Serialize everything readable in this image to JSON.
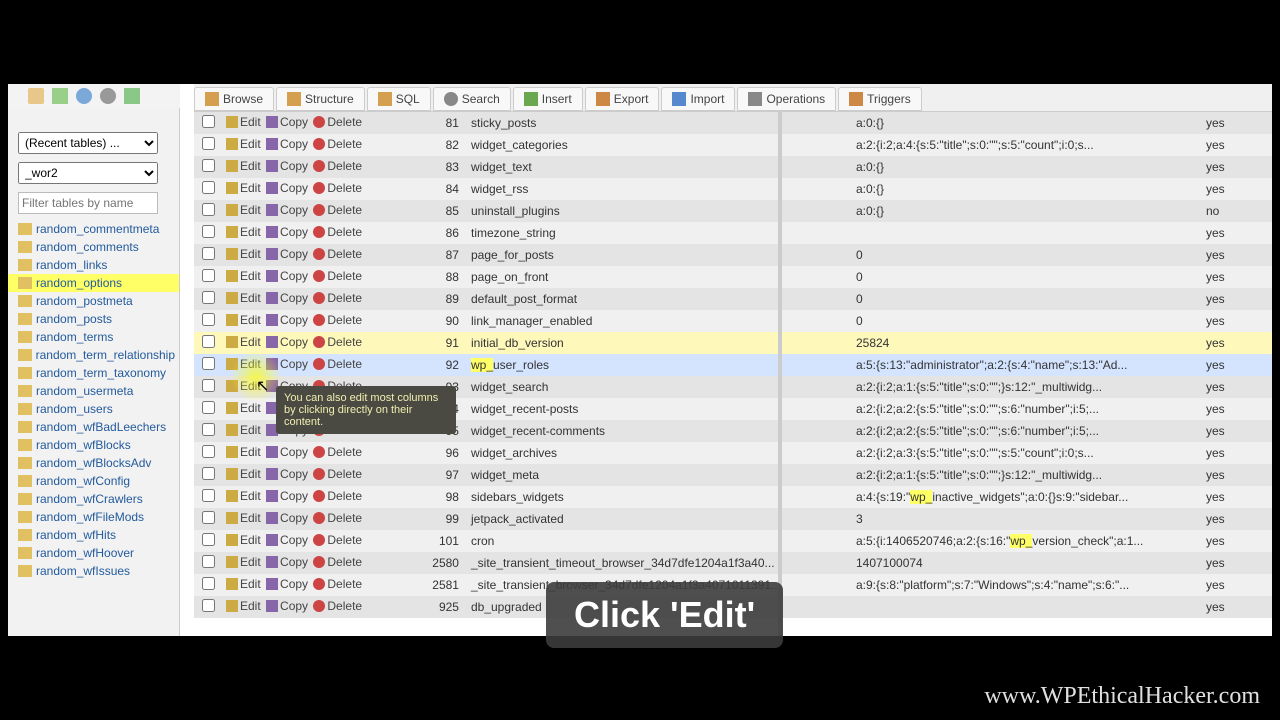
{
  "tabs": [
    {
      "label": "Browse",
      "ico": "browse"
    },
    {
      "label": "Structure",
      "ico": "struct"
    },
    {
      "label": "SQL",
      "ico": "sql"
    },
    {
      "label": "Search",
      "ico": "search"
    },
    {
      "label": "Insert",
      "ico": "insert"
    },
    {
      "label": "Export",
      "ico": "export"
    },
    {
      "label": "Import",
      "ico": "import"
    },
    {
      "label": "Operations",
      "ico": "ops"
    },
    {
      "label": "Triggers",
      "ico": "trig"
    }
  ],
  "sidebar": {
    "recent_label": "(Recent tables) ...",
    "db_label": "_wor2",
    "filter_placeholder": "Filter tables by name",
    "tables": [
      "random_commentmeta",
      "random_comments",
      "random_links",
      "random_options",
      "random_postmeta",
      "random_posts",
      "random_terms",
      "random_term_relationship",
      "random_term_taxonomy",
      "random_usermeta",
      "random_users",
      "random_wfBadLeechers",
      "random_wfBlocks",
      "random_wfBlocksAdv",
      "random_wfConfig",
      "random_wfCrawlers",
      "random_wfFileMods",
      "random_wfHits",
      "random_wfHoover",
      "random_wfIssues"
    ],
    "selected": 3
  },
  "actions": {
    "edit": "Edit",
    "copy": "Copy",
    "del": "Delete"
  },
  "rows": [
    {
      "id": "81",
      "name": "sticky_posts",
      "val": "a:0:{}",
      "yn": "yes"
    },
    {
      "id": "82",
      "name": "widget_categories",
      "val": "a:2:{i:2;a:4:{s:5:\"title\";s:0:\"\";s:5:\"count\";i:0;s...",
      "yn": "yes"
    },
    {
      "id": "83",
      "name": "widget_text",
      "val": "a:0:{}",
      "yn": "yes"
    },
    {
      "id": "84",
      "name": "widget_rss",
      "val": "a:0:{}",
      "yn": "yes"
    },
    {
      "id": "85",
      "name": "uninstall_plugins",
      "val": "a:0:{}",
      "yn": "no"
    },
    {
      "id": "86",
      "name": "timezone_string",
      "val": "",
      "yn": "yes"
    },
    {
      "id": "87",
      "name": "page_for_posts",
      "val": "0",
      "yn": "yes"
    },
    {
      "id": "88",
      "name": "page_on_front",
      "val": "0",
      "yn": "yes"
    },
    {
      "id": "89",
      "name": "default_post_format",
      "val": "0",
      "yn": "yes"
    },
    {
      "id": "90",
      "name": "link_manager_enabled",
      "val": "0",
      "yn": "yes"
    },
    {
      "id": "91",
      "name": "initial_db_version",
      "val": "25824",
      "yn": "yes"
    },
    {
      "id": "92",
      "name": "wp_user_roles",
      "val": "a:5:{s:13:\"administrator\";a:2:{s:4:\"name\";s:13:\"Ad...",
      "yn": "yes",
      "hl": true
    },
    {
      "id": "93",
      "name": "widget_search",
      "val": "a:2:{i:2;a:1:{s:5:\"title\";s:0:\"\";}s:12:\"_multiwidg...",
      "yn": "yes"
    },
    {
      "id": "94",
      "name": "widget_recent-posts",
      "val": "a:2:{i:2;a:2:{s:5:\"title\";s:0:\"\";s:6:\"number\";i:5;...",
      "yn": "yes"
    },
    {
      "id": "95",
      "name": "widget_recent-comments",
      "val": "a:2:{i:2;a:2:{s:5:\"title\";s:0:\"\";s:6:\"number\";i:5;...",
      "yn": "yes"
    },
    {
      "id": "96",
      "name": "widget_archives",
      "val": "a:2:{i:2;a:3:{s:5:\"title\";s:0:\"\";s:5:\"count\";i:0;s...",
      "yn": "yes"
    },
    {
      "id": "97",
      "name": "widget_meta",
      "val": "a:2:{i:2;a:1:{s:5:\"title\";s:0:\"\";}s:12:\"_multiwidg...",
      "yn": "yes"
    },
    {
      "id": "98",
      "name": "sidebars_widgets",
      "val": "a:4:{s:19:\"wp_inactive_widgets\";a:0:{}s:9:\"sidebar...",
      "yn": "yes",
      "hlvalpart": "wp_"
    },
    {
      "id": "99",
      "name": "jetpack_activated",
      "val": "3",
      "yn": "yes"
    },
    {
      "id": "101",
      "name": "cron",
      "val": "a:5:{i:1406520746;a:2:{s:16:\"wp_version_check\";a:1...",
      "yn": "yes",
      "hlvalpart": "wp_"
    },
    {
      "id": "2580",
      "name": "_site_transient_timeout_browser_34d7dfe1204a1f3a40...",
      "val": "1407100074",
      "yn": "yes"
    },
    {
      "id": "2581",
      "name": "_site_transient_browser_34d7dfe1204a1f3a4071011391...",
      "val": "a:9:{s:8:\"platform\";s:7:\"Windows\";s:4:\"name\";s:6:\"...",
      "yn": "yes"
    },
    {
      "id": "925",
      "name": "db_upgraded",
      "val": "",
      "yn": "yes"
    }
  ],
  "tooltip": "You can also edit most columns by clicking directly on their content.",
  "caption": "Click 'Edit'",
  "watermark": "www.WPEthicalHacker.com"
}
